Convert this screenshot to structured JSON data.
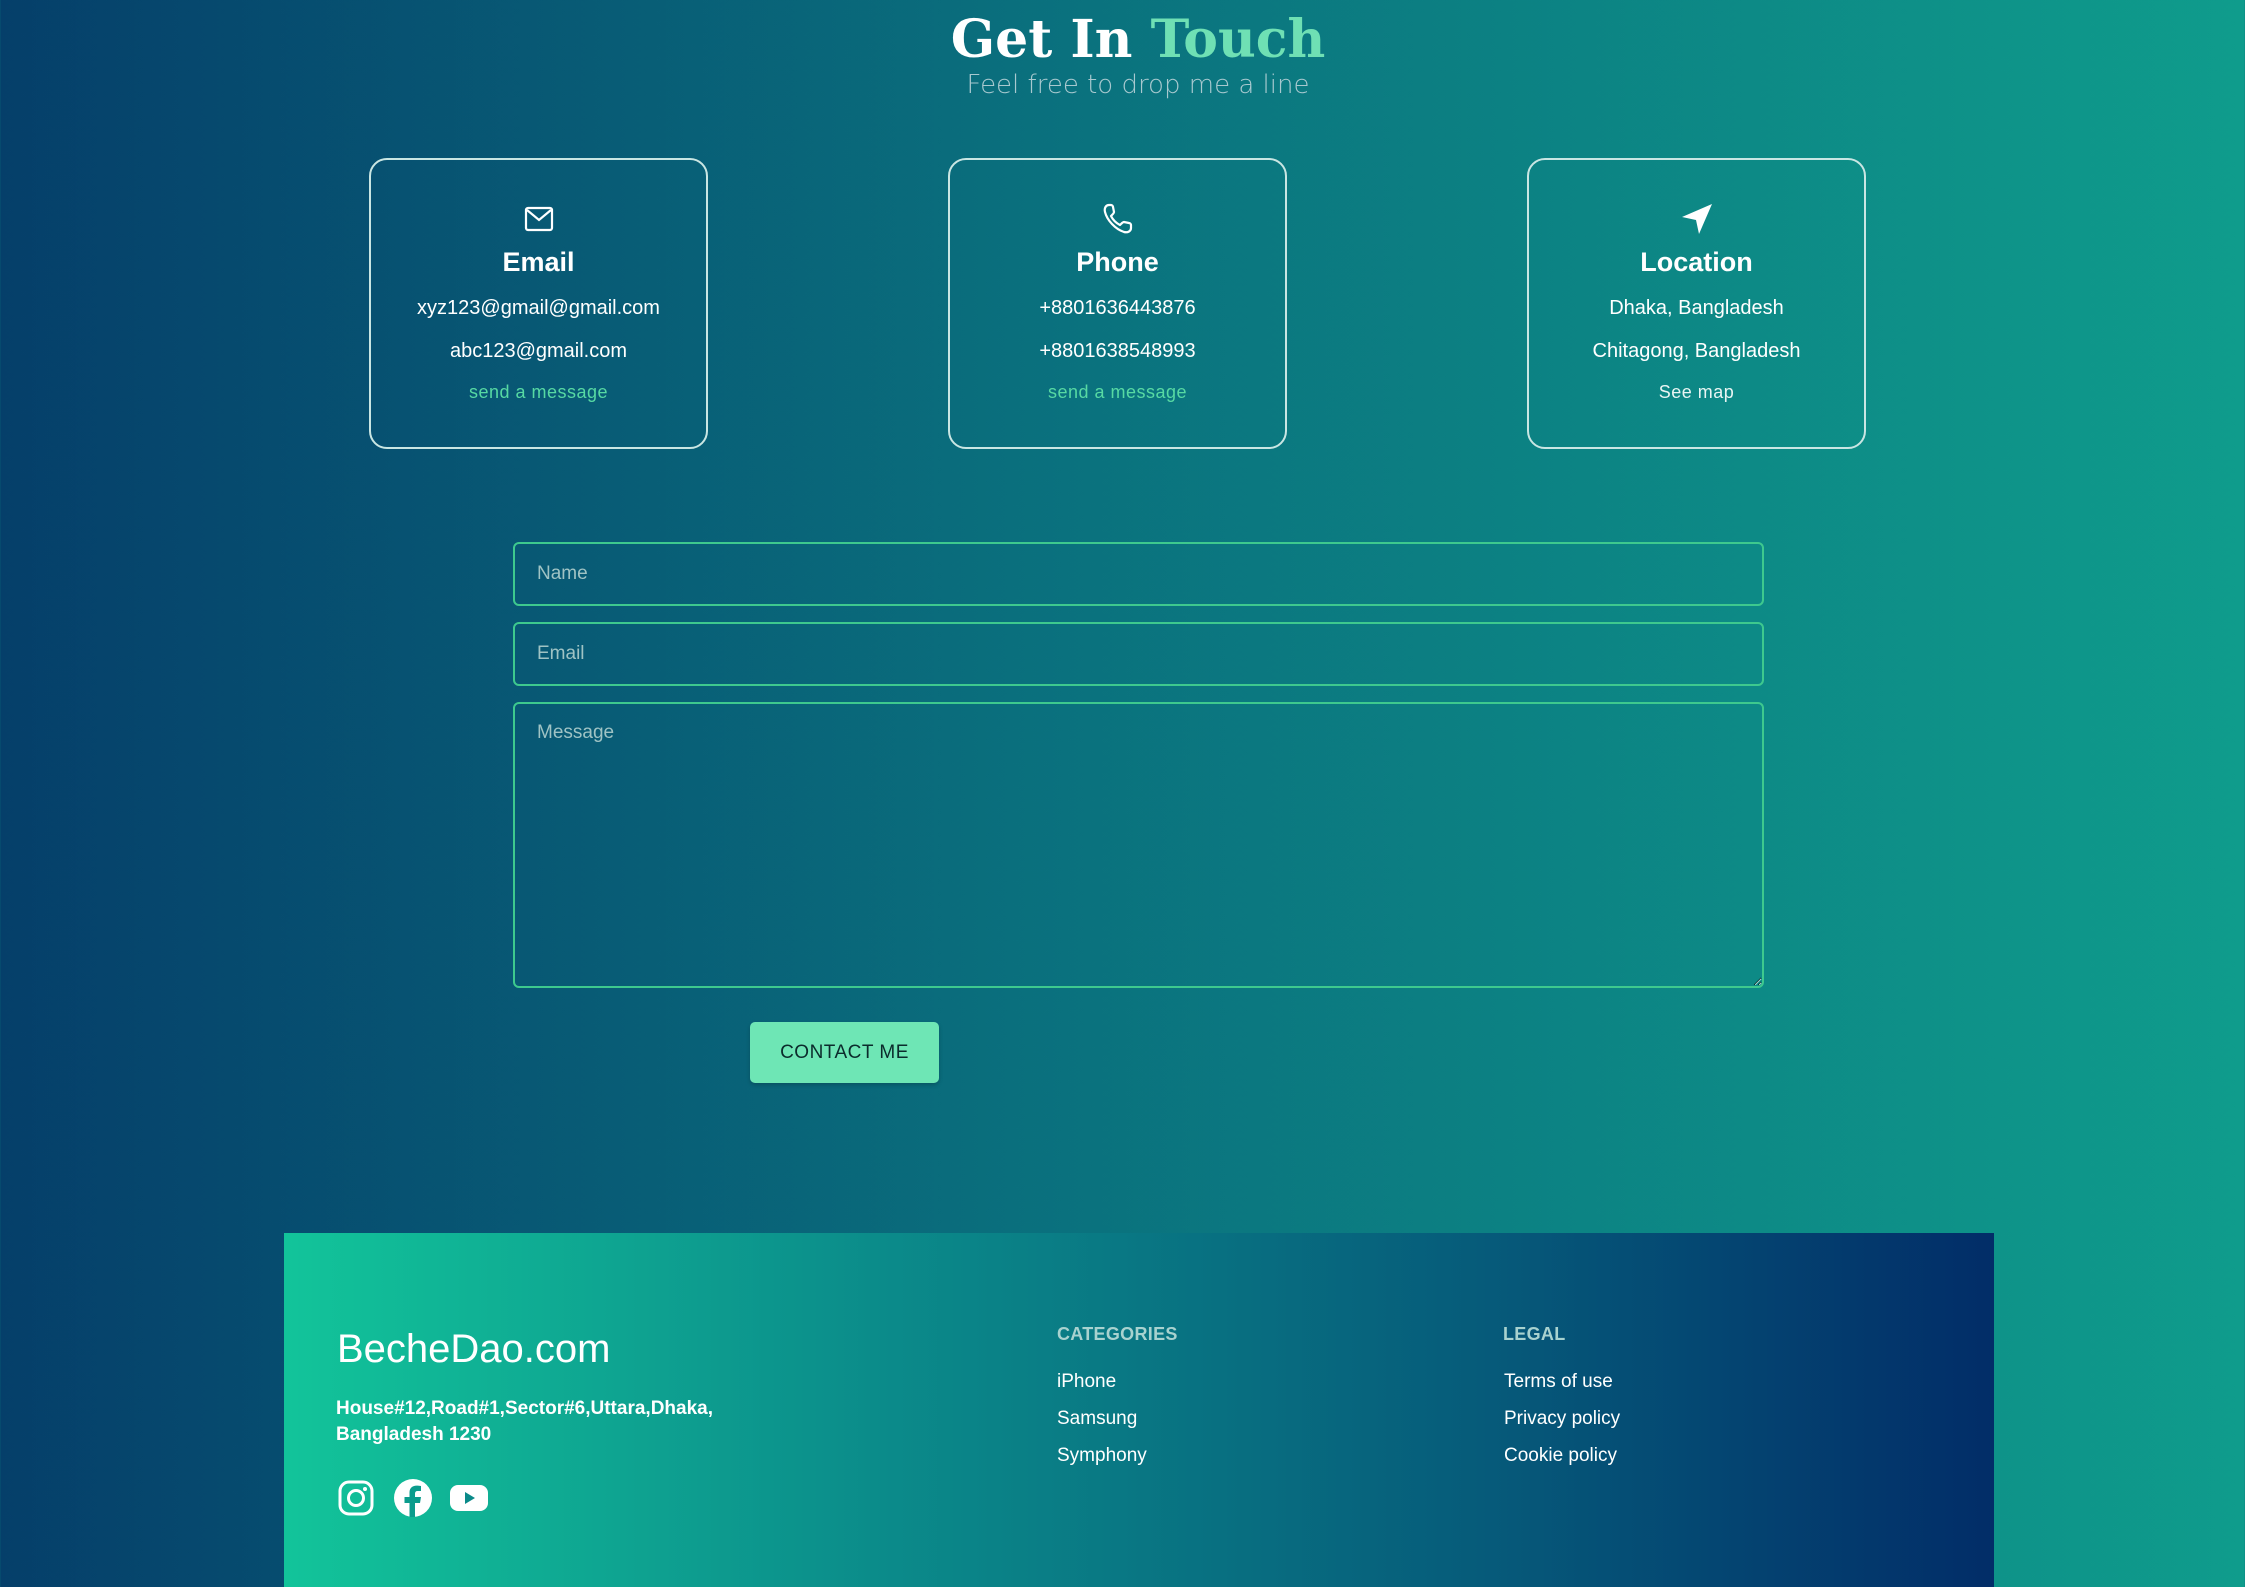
{
  "hero": {
    "title_word1": "Get In",
    "title_word2": "Touch",
    "subtitle": "Feel free to drop me a line"
  },
  "cards": {
    "email": {
      "icon": "mail-icon",
      "title": "Email",
      "line1": "xyz123@gmail@gmail.com",
      "line2": "abc123@gmail.com",
      "link": "send a message"
    },
    "phone": {
      "icon": "phone-icon",
      "title": "Phone",
      "line1": "+8801636443876",
      "line2": "+8801638548993",
      "link": "send a message"
    },
    "location": {
      "icon": "navigation-arrow-icon",
      "title": "Location",
      "line1": "Dhaka, Bangladesh",
      "line2": "Chitagong, Bangladesh",
      "link": "See map"
    }
  },
  "form": {
    "name_placeholder": "Name",
    "email_placeholder": "Email",
    "message_placeholder": "Message",
    "submit_label": "CONTACT ME"
  },
  "footer": {
    "brand": "BecheDao.com",
    "address": "House#12,Road#1,Sector#6,Uttara,Dhaka, Bangladesh 1230",
    "social_icons": [
      "instagram-icon",
      "facebook-icon",
      "youtube-icon"
    ],
    "categories": {
      "heading": "CATEGORIES",
      "items": [
        "iPhone",
        "Samsung",
        "Symphony"
      ]
    },
    "legal": {
      "heading": "LEGAL",
      "items": [
        "Terms of use",
        "Privacy policy",
        "Cookie policy"
      ]
    }
  },
  "colors": {
    "accent": "#6fe0b4",
    "button": "#6ee6b5",
    "link": "#57d9a3",
    "input_border": "#3ec98e"
  }
}
